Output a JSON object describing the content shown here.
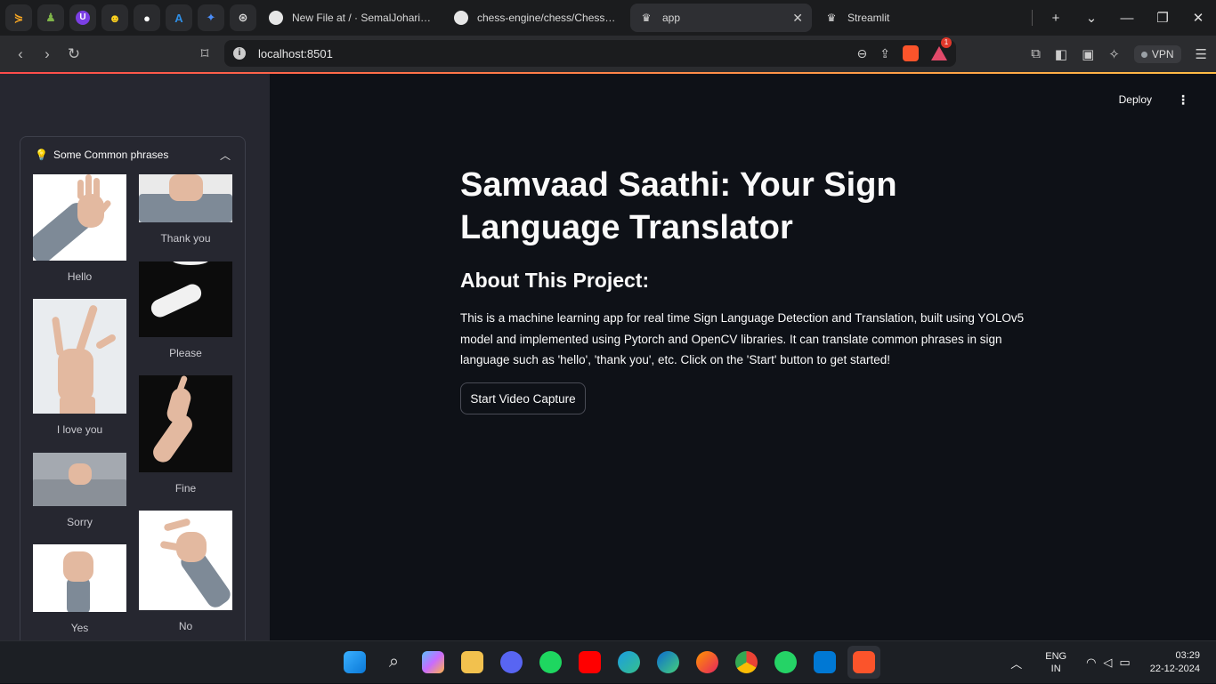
{
  "browser": {
    "pinned_tabs": [
      "pin-1",
      "pin-2",
      "pin-3",
      "pin-4",
      "github",
      "azure",
      "copilot",
      "openai"
    ],
    "tabs": [
      {
        "title": "New File at / · SemalJohari/Sar",
        "icon": "github-icon"
      },
      {
        "title": "chess-engine/chess/ChessEng",
        "icon": "github-icon"
      },
      {
        "title": "app",
        "icon": "streamlit-crown-icon",
        "active": true
      },
      {
        "title": "Streamlit",
        "icon": "streamlit-crown-icon"
      }
    ],
    "url": "localhost:8501",
    "vpn_label": "VPN",
    "notification_count": "1"
  },
  "sidebar": {
    "expander_title": "Some Common phrases",
    "phrases": [
      {
        "label": "Hello"
      },
      {
        "label": "Thank you"
      },
      {
        "label": "Please"
      },
      {
        "label": "I love you"
      },
      {
        "label": "Fine"
      },
      {
        "label": "Sorry"
      },
      {
        "label": "Yes"
      },
      {
        "label": "No"
      }
    ]
  },
  "main": {
    "deploy_label": "Deploy",
    "title": "Samvaad Saathi: Your Sign Language Translator",
    "about_heading": "About This Project:",
    "about_text": "This is a machine learning app for real time Sign Language Detection and Translation, built using YOLOv5 model and implemented using Pytorch and OpenCV libraries. It can translate common phrases in sign language such as 'hello', 'thank you', etc. Click on the 'Start' button to get started!",
    "start_button": "Start Video Capture"
  },
  "taskbar": {
    "language": "ENG",
    "region": "IN",
    "time": "03:29",
    "date": "22-12-2024"
  },
  "colors": {
    "app_background": "#0e1117",
    "sidebar_background": "#262730",
    "accent_gradient_start": "#ff4b4b",
    "accent_gradient_end": "#ffbd45"
  }
}
